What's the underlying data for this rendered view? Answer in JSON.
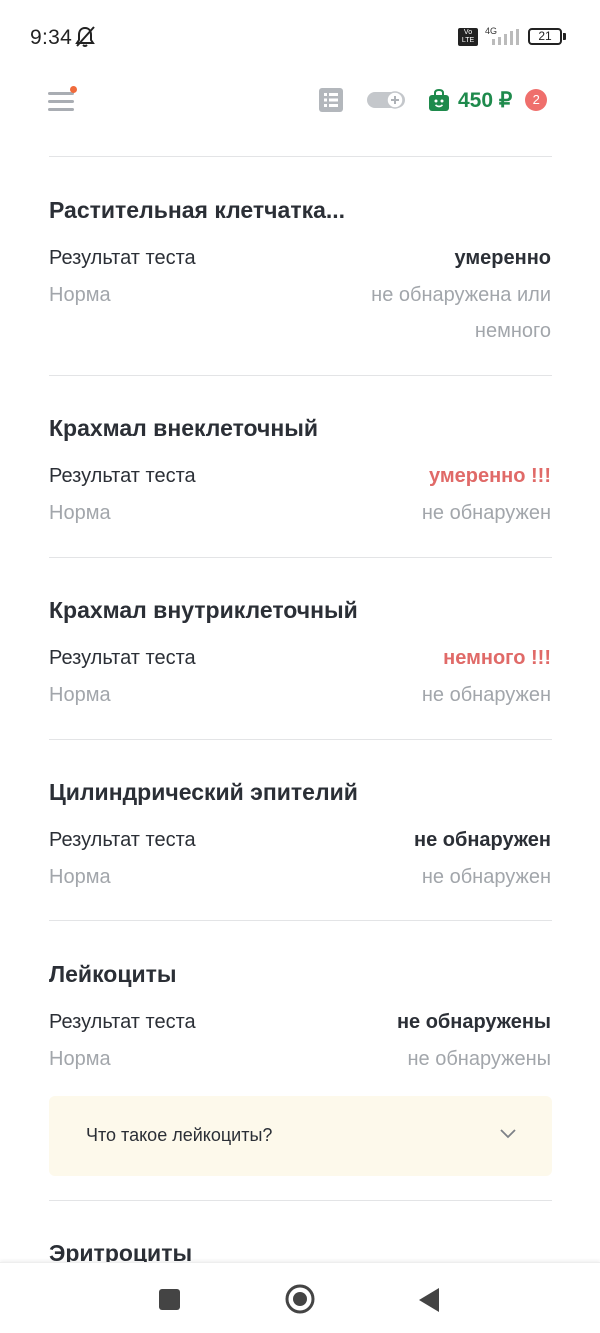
{
  "status_bar": {
    "time": "9:34",
    "volte": "Vo LTE",
    "network": "4G",
    "battery": "21"
  },
  "header": {
    "cart_price": "450 ₽",
    "cart_badge": "2"
  },
  "sections": [
    {
      "title": "Растительная клетчатка...",
      "result_label": "Результат теста",
      "result_value": "умеренно",
      "norm_label": "Норма",
      "norm_value": "не обнаружена или немного"
    },
    {
      "title": "Крахмал внеклеточный",
      "result_label": "Результат теста",
      "result_value": "умеренно !!!",
      "norm_label": "Норма",
      "norm_value": "не обнаружен"
    },
    {
      "title": "Крахмал внутриклеточный",
      "result_label": "Результат теста",
      "result_value": "немного !!!",
      "norm_label": "Норма",
      "norm_value": "не обнаружен"
    },
    {
      "title": "Цилиндрический эпителий",
      "result_label": "Результат теста",
      "result_value": "не обнаружен",
      "norm_label": "Норма",
      "norm_value": "не обнаружен"
    },
    {
      "title": "Лейкоциты",
      "result_label": "Результат теста",
      "result_value": "не обнаружены",
      "norm_label": "Норма",
      "norm_value": "не обнаружены",
      "info": "Что такое лейкоциты?"
    },
    {
      "title": "Эритроциты"
    }
  ],
  "colors": {
    "accent_green": "#1e8a4c",
    "alert_red": "#e06a68",
    "info_bg": "#fdf9eb"
  }
}
